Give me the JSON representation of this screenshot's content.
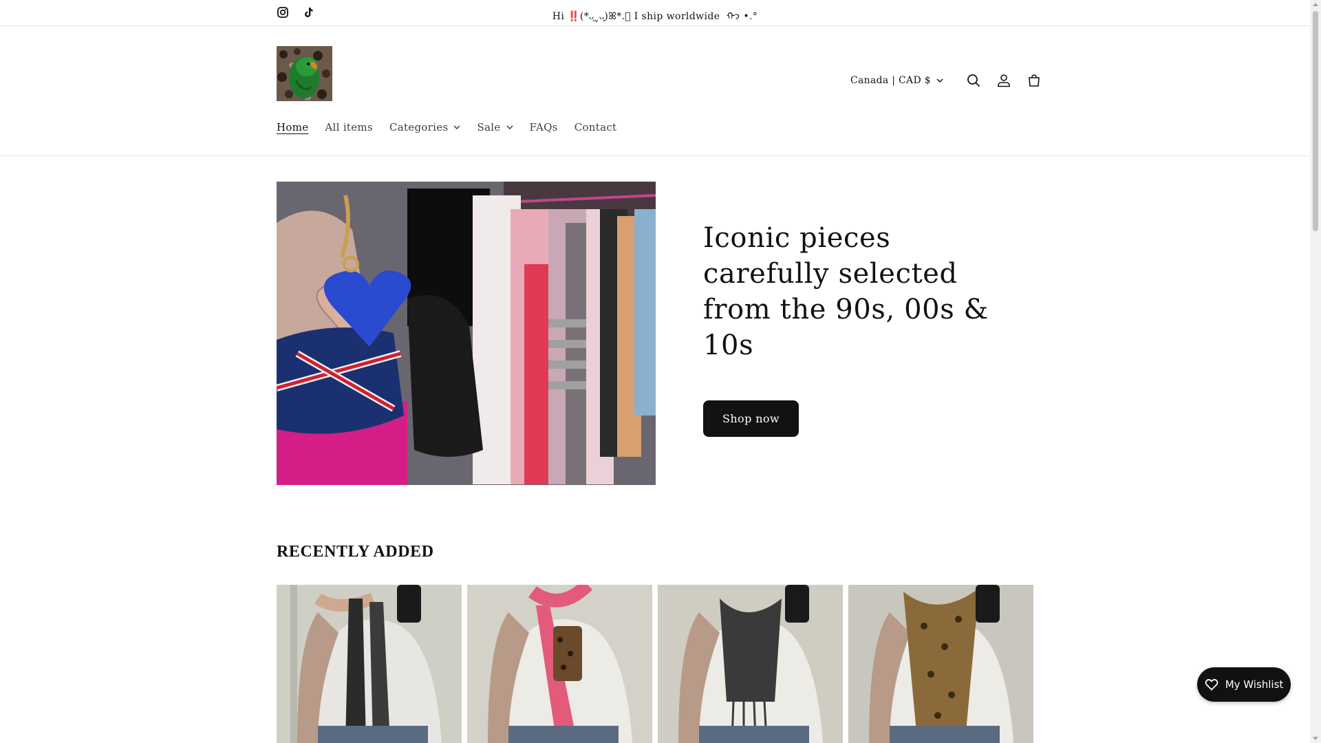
{
  "announcement": {
    "message": "Hi ‼️(*ᴗ͈ˬᴗ͈)ꕤ*.゚ I ship worldwide ⁠ ᡣ𐭩 •.°",
    "social": [
      "instagram-icon",
      "tiktok-icon"
    ]
  },
  "header": {
    "logo_alt": "Parrot logo",
    "country_selector": "Canada | CAD $",
    "icons": [
      "search-icon",
      "account-icon",
      "cart-icon"
    ]
  },
  "nav": {
    "items": [
      {
        "label": "Home",
        "active": true,
        "dropdown": false
      },
      {
        "label": "All items",
        "active": false,
        "dropdown": false
      },
      {
        "label": "Categories",
        "active": false,
        "dropdown": true
      },
      {
        "label": "Sale",
        "active": false,
        "dropdown": true
      },
      {
        "label": "FAQs",
        "active": false,
        "dropdown": false
      },
      {
        "label": "Contact",
        "active": false,
        "dropdown": false
      }
    ]
  },
  "hero": {
    "title": "Iconic pieces carefully selected from the 90s, 00s & 10s",
    "button_label": "Shop now"
  },
  "recently_added": {
    "title": "RECENTLY ADDED",
    "products": [
      {
        "scarf_color": "#2b2b2b"
      },
      {
        "scarf_color": "#e35a7a"
      },
      {
        "scarf_color": "#3a3a3a"
      },
      {
        "scarf_color": "#8a6a3a"
      }
    ]
  },
  "wishlist": {
    "label": "My Wishlist"
  },
  "colors": {
    "text": "#121212",
    "button_bg": "#121212",
    "border": "#e3e3e3"
  }
}
